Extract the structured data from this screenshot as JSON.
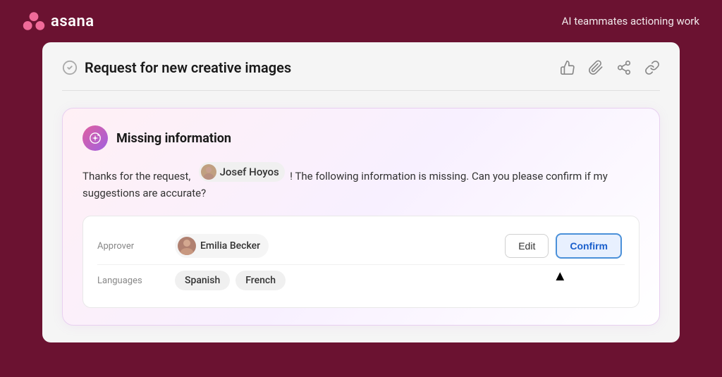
{
  "header": {
    "logo_text": "asana",
    "tagline": "AI teammates actioning work"
  },
  "task": {
    "title": "Request for new creative images",
    "actions": [
      "thumbs-up",
      "attachment",
      "branch",
      "link"
    ]
  },
  "ai_card": {
    "title": "Missing information",
    "message_before": "Thanks for the request,",
    "user_name": "Josef Hoyos",
    "message_after": "! The following information is missing. Can you please confirm if my suggestions are accurate?",
    "fields": [
      {
        "label": "Approver",
        "value": "Emilia Becker",
        "type": "user"
      },
      {
        "label": "Languages",
        "values": [
          "Spanish",
          "French"
        ],
        "type": "tags"
      }
    ],
    "buttons": {
      "edit": "Edit",
      "confirm": "Confirm"
    }
  }
}
